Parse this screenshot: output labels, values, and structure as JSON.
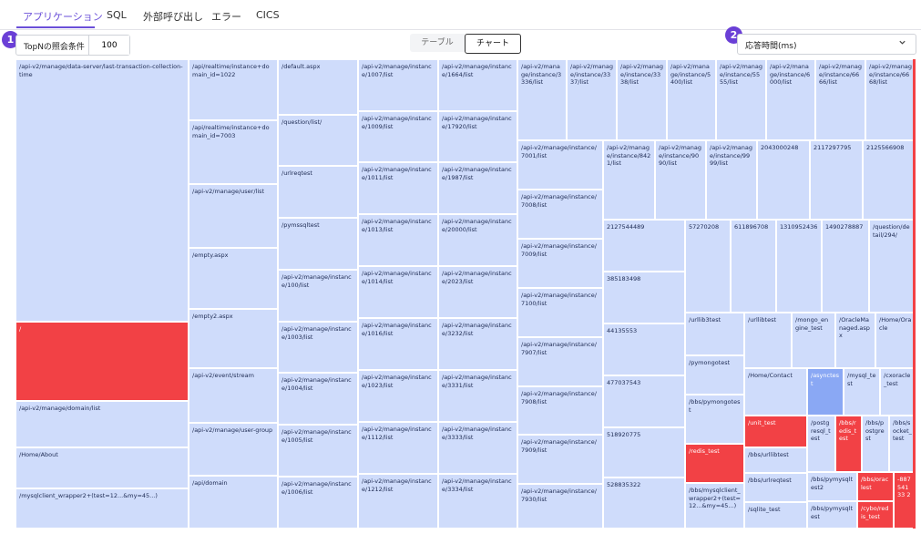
{
  "tabs": [
    {
      "label": "アプリケーション",
      "active": true
    },
    {
      "label": "SQL",
      "active": false
    },
    {
      "label": "外部呼び出し",
      "active": false
    },
    {
      "label": "エラー",
      "active": false
    },
    {
      "label": "CICS",
      "active": false
    }
  ],
  "markers": {
    "first": "1",
    "second": "2"
  },
  "topn": {
    "label": "TopNの照会条件",
    "value": "100"
  },
  "view_toggle": {
    "table": "テーブル",
    "chart": "チャート",
    "selected": "チャート"
  },
  "metric_select": {
    "value": "応答時間(ms)",
    "icon": "chevron-down-icon"
  },
  "colors": {
    "accent": "#6a4fd8",
    "cell": "#cfdcfb",
    "hot": "#f24145",
    "warm": "#8aa8f4"
  },
  "treemap": {
    "cells": [
      {
        "label": "/api-v2/manage/data-server/last-transaction-collection-time",
        "tone": "normal"
      },
      {
        "label": "/",
        "tone": "hot"
      },
      {
        "label": "/api-v2/manage/domain/list",
        "tone": "normal"
      },
      {
        "label": "/Home/About",
        "tone": "normal"
      },
      {
        "label": "/mysqlclient_wrapper2+(test=12...&my=45...)",
        "tone": "normal"
      },
      {
        "label": "/api/realtime/instance+domain_id=1022",
        "tone": "normal"
      },
      {
        "label": "/api/realtime/instance+domain_id=7003",
        "tone": "normal"
      },
      {
        "label": "/api-v2/manage/user/list",
        "tone": "normal"
      },
      {
        "label": "/empty.aspx",
        "tone": "normal"
      },
      {
        "label": "/empty2.aspx",
        "tone": "normal"
      },
      {
        "label": "/api-v2/event/stream",
        "tone": "normal"
      },
      {
        "label": "/api-v2/manage/user-group",
        "tone": "normal"
      },
      {
        "label": "/api/domain",
        "tone": "normal"
      },
      {
        "label": "/default.aspx",
        "tone": "normal"
      },
      {
        "label": "/question/list/",
        "tone": "normal"
      },
      {
        "label": "/urlreqtest",
        "tone": "normal"
      },
      {
        "label": "/pymssqltest",
        "tone": "normal"
      },
      {
        "label": "/api-v2/manage/instance/100/list",
        "tone": "normal"
      },
      {
        "label": "/api-v2/manage/instance/1003/list",
        "tone": "normal"
      },
      {
        "label": "/api-v2/manage/instance/1004/list",
        "tone": "normal"
      },
      {
        "label": "/api-v2/manage/instance/1005/list",
        "tone": "normal"
      },
      {
        "label": "/api-v2/manage/instance/1006/list",
        "tone": "normal"
      },
      {
        "label": "/api-v2/manage/instance/1007/list",
        "tone": "normal"
      },
      {
        "label": "/api-v2/manage/instance/1009/list",
        "tone": "normal"
      },
      {
        "label": "/api-v2/manage/instance/1011/list",
        "tone": "normal"
      },
      {
        "label": "/api-v2/manage/instance/1013/list",
        "tone": "normal"
      },
      {
        "label": "/api-v2/manage/instance/1014/list",
        "tone": "normal"
      },
      {
        "label": "/api-v2/manage/instance/1016/list",
        "tone": "normal"
      },
      {
        "label": "/api-v2/manage/instance/1023/list",
        "tone": "normal"
      },
      {
        "label": "/api-v2/manage/instance/1112/list",
        "tone": "normal"
      },
      {
        "label": "/api-v2/manage/instance/1212/list",
        "tone": "normal"
      },
      {
        "label": "/api-v2/manage/instance/1664/list",
        "tone": "normal"
      },
      {
        "label": "/api-v2/manage/instance/17920/list",
        "tone": "normal"
      },
      {
        "label": "/api-v2/manage/instance/1987/list",
        "tone": "normal"
      },
      {
        "label": "/api-v2/manage/instance/20000/list",
        "tone": "normal"
      },
      {
        "label": "/api-v2/manage/instance/2023/list",
        "tone": "normal"
      },
      {
        "label": "/api-v2/manage/instance/3232/list",
        "tone": "normal"
      },
      {
        "label": "/api-v2/manage/instance/3331/list",
        "tone": "normal"
      },
      {
        "label": "/api-v2/manage/instance/3333/list",
        "tone": "normal"
      },
      {
        "label": "/api-v2/manage/instance/3334/list",
        "tone": "normal"
      },
      {
        "label": "/api-v2/manage/instance/3336/list",
        "tone": "normal"
      },
      {
        "label": "/api-v2/manage/instance/7001/list",
        "tone": "normal"
      },
      {
        "label": "/api-v2/manage/instance/7008/list",
        "tone": "normal"
      },
      {
        "label": "/api-v2/manage/instance/7009/list",
        "tone": "normal"
      },
      {
        "label": "/api-v2/manage/instance/7100/list",
        "tone": "normal"
      },
      {
        "label": "/api-v2/manage/instance/7907/list",
        "tone": "normal"
      },
      {
        "label": "/api-v2/manage/instance/7908/list",
        "tone": "normal"
      },
      {
        "label": "/api-v2/manage/instance/7909/list",
        "tone": "normal"
      },
      {
        "label": "/api-v2/manage/instance/7930/list",
        "tone": "normal"
      },
      {
        "label": "/api-v2/manage/instance/3337/list",
        "tone": "normal"
      },
      {
        "label": "/api-v2/manage/instance/3338/list",
        "tone": "normal"
      },
      {
        "label": "/api-v2/manage/instance/5400/list",
        "tone": "normal"
      },
      {
        "label": "/api-v2/manage/instance/5555/list",
        "tone": "normal"
      },
      {
        "label": "/api-v2/manage/instance/6000/list",
        "tone": "normal"
      },
      {
        "label": "/api-v2/manage/instance/6666/list",
        "tone": "normal"
      },
      {
        "label": "/api-v2/manage/instance/6668/list",
        "tone": "normal"
      },
      {
        "label": "/api-v2/manage/instance/8421/list",
        "tone": "normal"
      },
      {
        "label": "/api-v2/manage/instance/9090/list",
        "tone": "normal"
      },
      {
        "label": "/api-v2/manage/instance/9999/list",
        "tone": "normal"
      },
      {
        "label": "2043000248",
        "tone": "normal"
      },
      {
        "label": "2117297795",
        "tone": "normal"
      },
      {
        "label": "2125566908",
        "tone": "normal"
      },
      {
        "label": "2127544489",
        "tone": "normal"
      },
      {
        "label": "385183498",
        "tone": "normal"
      },
      {
        "label": "44135553",
        "tone": "normal"
      },
      {
        "label": "477037543",
        "tone": "normal"
      },
      {
        "label": "518920775",
        "tone": "normal"
      },
      {
        "label": "528835322",
        "tone": "normal"
      },
      {
        "label": "57270208",
        "tone": "normal"
      },
      {
        "label": "611896708",
        "tone": "normal"
      },
      {
        "label": "1310952436",
        "tone": "normal"
      },
      {
        "label": "1490278887",
        "tone": "normal"
      },
      {
        "label": "/question/detail/294/",
        "tone": "normal"
      },
      {
        "label": "/urllib3test",
        "tone": "normal"
      },
      {
        "label": "/urllibtest",
        "tone": "normal"
      },
      {
        "label": "/mongo_engine_test",
        "tone": "normal"
      },
      {
        "label": "/OracleManaged.aspx",
        "tone": "normal"
      },
      {
        "label": "/Home/Oracle",
        "tone": "normal"
      },
      {
        "label": "/pymongotest",
        "tone": "normal"
      },
      {
        "label": "/bbs/pymongotest",
        "tone": "normal"
      },
      {
        "label": "/redis_test",
        "tone": "hot"
      },
      {
        "label": "/bbs/mysqlclient_wrapper2+(test=12...&my=45...)",
        "tone": "normal"
      },
      {
        "label": "/Home/Contact",
        "tone": "normal"
      },
      {
        "label": "/asynctest",
        "tone": "warm"
      },
      {
        "label": "/mysql_test",
        "tone": "normal"
      },
      {
        "label": "/cxoracle_test",
        "tone": "normal"
      },
      {
        "label": "/unit_test",
        "tone": "hot"
      },
      {
        "label": "/postgresql_test",
        "tone": "normal"
      },
      {
        "label": "/bbs/redis_test",
        "tone": "hot"
      },
      {
        "label": "/bbs/postgrest",
        "tone": "normal"
      },
      {
        "label": "/bbs/socket_test",
        "tone": "normal"
      },
      {
        "label": "/bbs/urllibtest",
        "tone": "normal"
      },
      {
        "label": "/bbs/urlreqtest",
        "tone": "normal"
      },
      {
        "label": "/bbs/pymysqltest2",
        "tone": "normal"
      },
      {
        "label": "/bbs/oraclest",
        "tone": "hot"
      },
      {
        "label": "-88754133 2",
        "tone": "hot"
      },
      {
        "label": "/sqlite_test",
        "tone": "normal"
      },
      {
        "label": "/bbs/pymysqltest",
        "tone": "normal"
      },
      {
        "label": "/cybo/redis_test",
        "tone": "hot"
      }
    ]
  }
}
